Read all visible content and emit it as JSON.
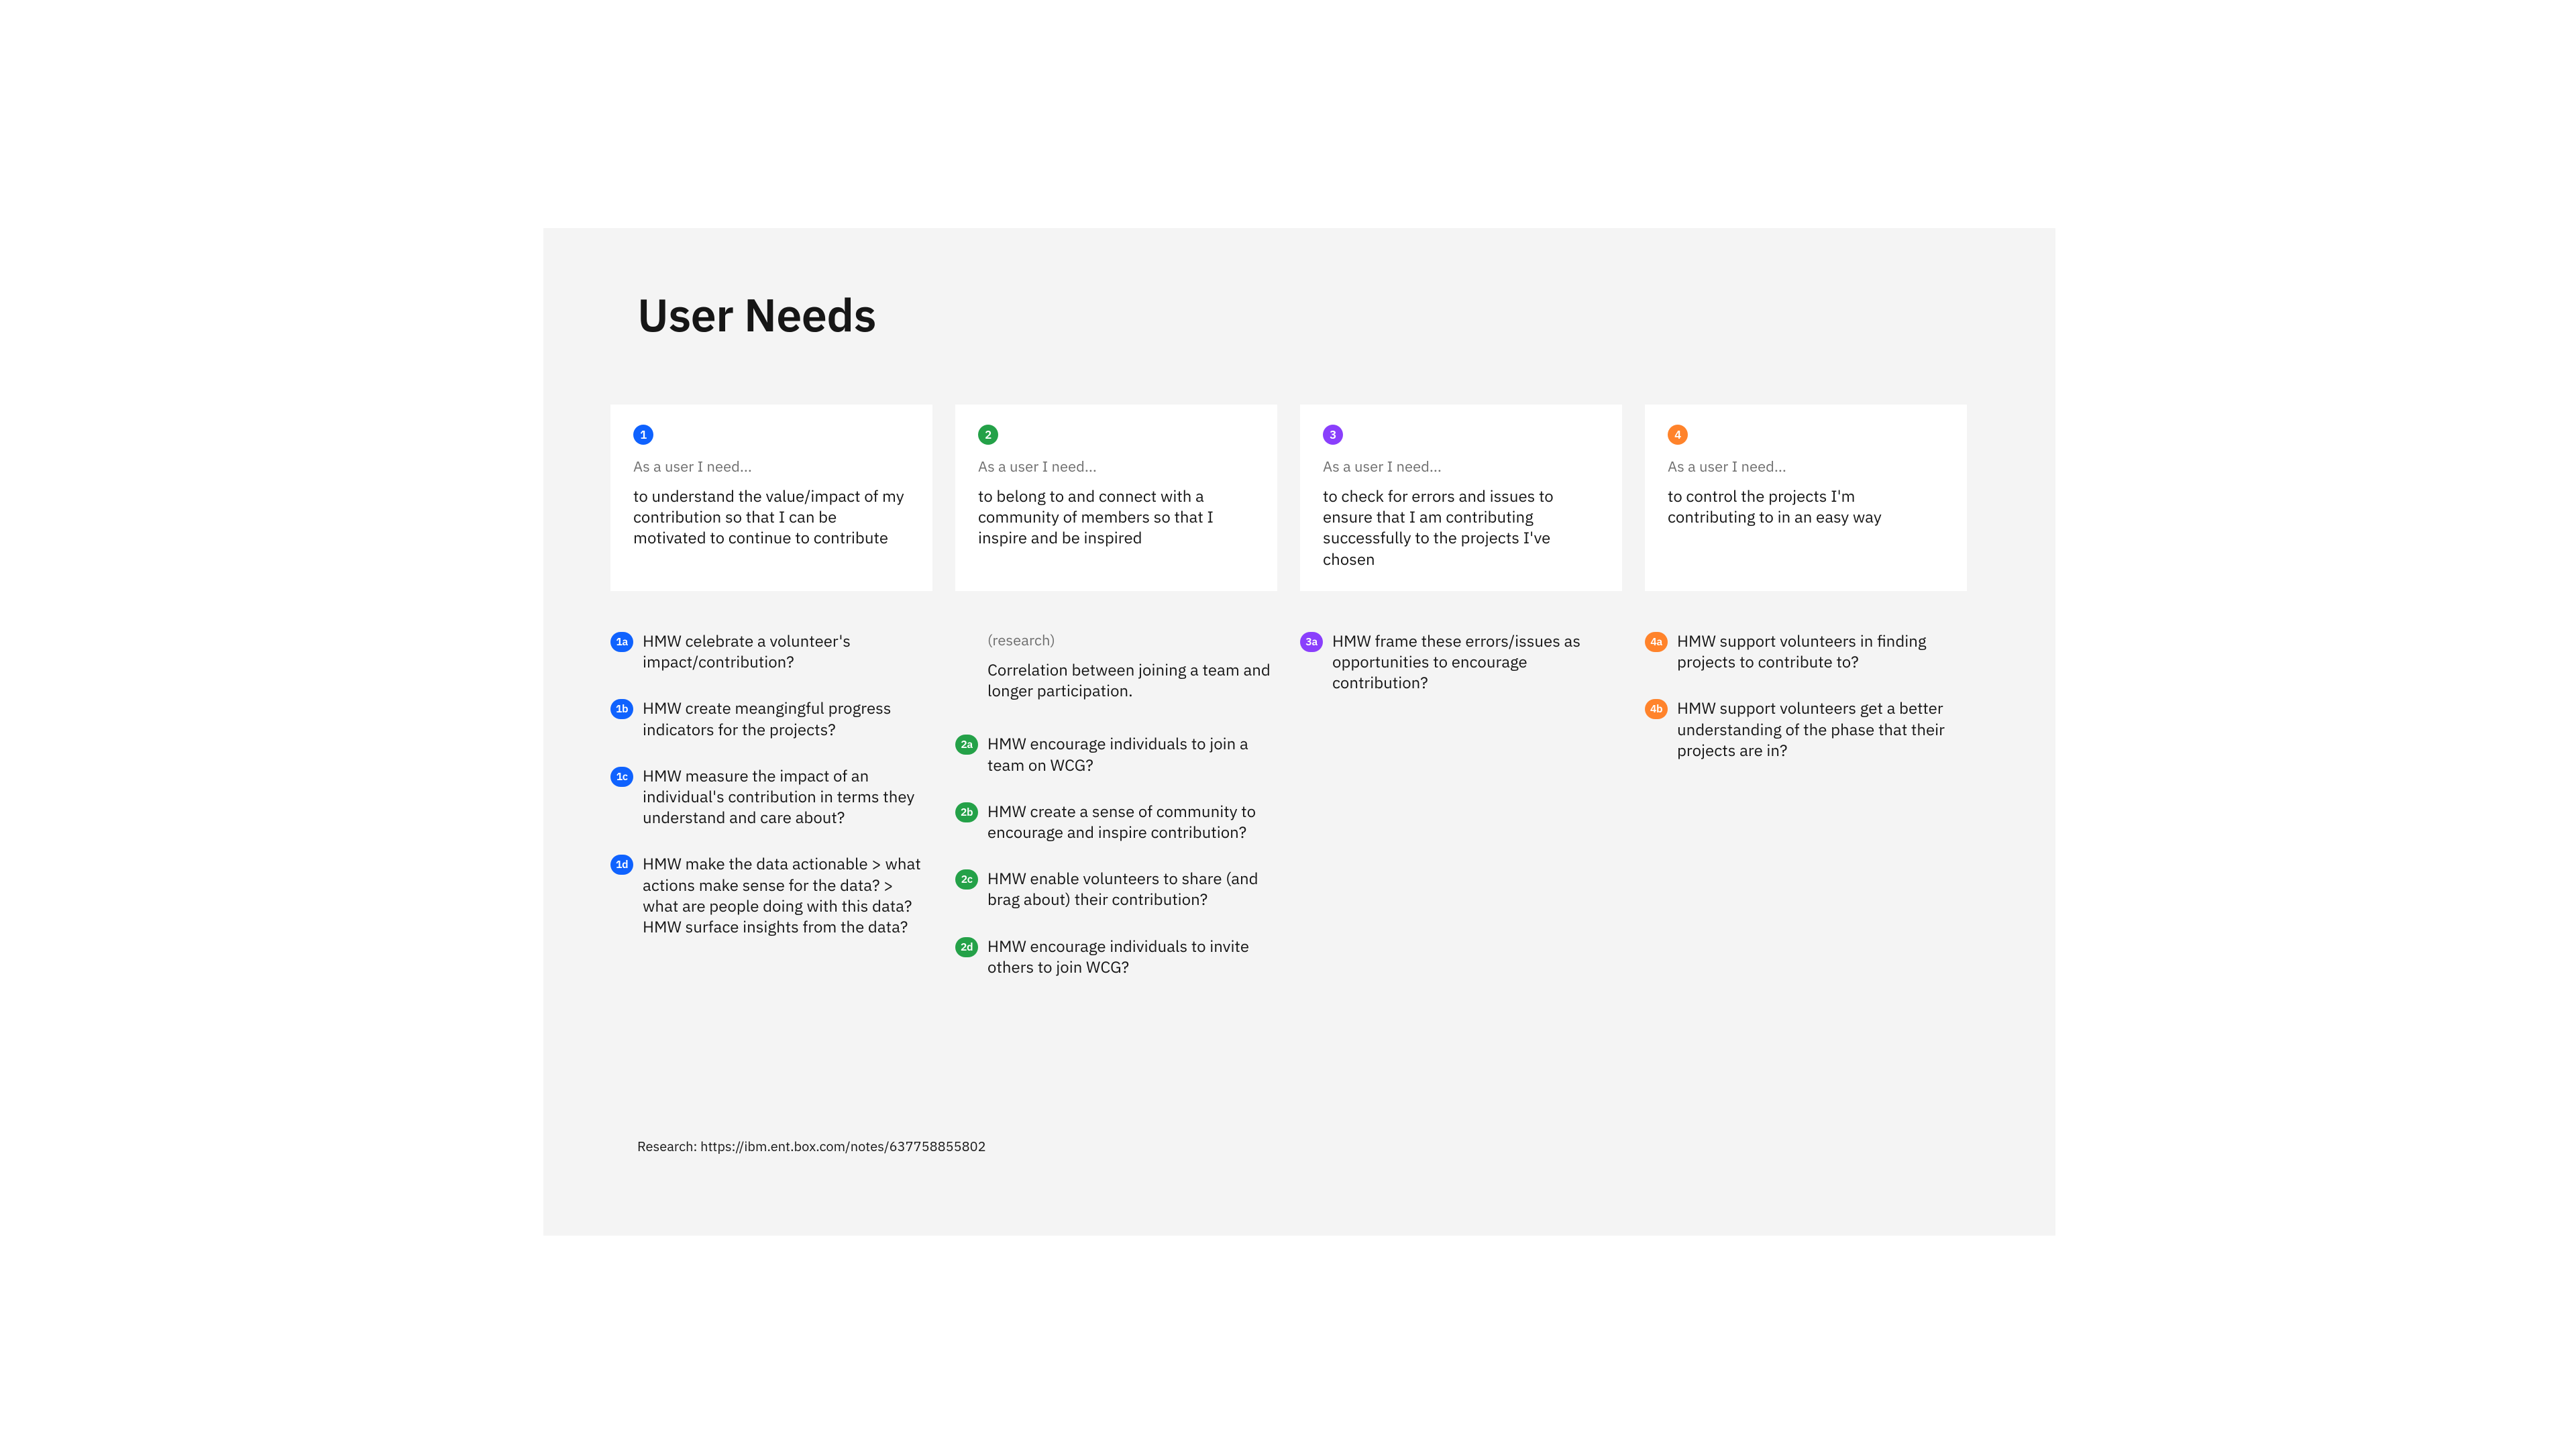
{
  "title": "User Needs",
  "prompt": "As a user I need...",
  "colors": {
    "c1": "#0f62fe",
    "c2": "#24a148",
    "c3": "#8a3ffc",
    "c4": "#ff832b"
  },
  "cards": [
    {
      "num": "1",
      "text": "to understand the value/impact of my contribution so that I can be motivated to continue to contribute"
    },
    {
      "num": "2",
      "text": "to belong to and connect with a community of members so that I inspire and be inspired"
    },
    {
      "num": "3",
      "text": "to check for errors and issues to ensure that I am contributing successfully to the projects I've chosen"
    },
    {
      "num": "4",
      "text": "to control the projects I'm contributing to in an easy way"
    }
  ],
  "col1": [
    {
      "tag": "1a",
      "text": "HMW celebrate a volunteer's impact/contribution?"
    },
    {
      "tag": "1b",
      "text": "HMW create meangingful progress indicators for the projects?"
    },
    {
      "tag": "1c",
      "text": "HMW measure the impact of an individual's contribution in terms they understand and care about?"
    },
    {
      "tag": "1d",
      "text": "HMW make the data actionable > what actions make sense for the data? > what are people doing with this data? HMW surface insights from the data?"
    }
  ],
  "col2_research_label": "(research)",
  "col2_research_text": "Correlation between joining a team and longer participation.",
  "col2": [
    {
      "tag": "2a",
      "text": "HMW encourage individuals to join a team on WCG?"
    },
    {
      "tag": "2b",
      "text": "HMW create a sense of community to encourage and inspire contribution?"
    },
    {
      "tag": "2c",
      "text": "HMW enable volunteers to share (and brag about) their contribution?"
    },
    {
      "tag": "2d",
      "text": "HMW encourage individuals to invite others to join WCG?"
    }
  ],
  "col3": [
    {
      "tag": "3a",
      "text": "HMW frame these errors/issues as opportunities to encourage contribution?"
    }
  ],
  "col4": [
    {
      "tag": "4a",
      "text": "HMW support volunteers in finding projects to contribute to?"
    },
    {
      "tag": "4b",
      "text": "HMW support volunteers get a better understanding of the phase that their projects are in?"
    }
  ],
  "footer": "Research: https://ibm.ent.box.com/notes/637758855802"
}
